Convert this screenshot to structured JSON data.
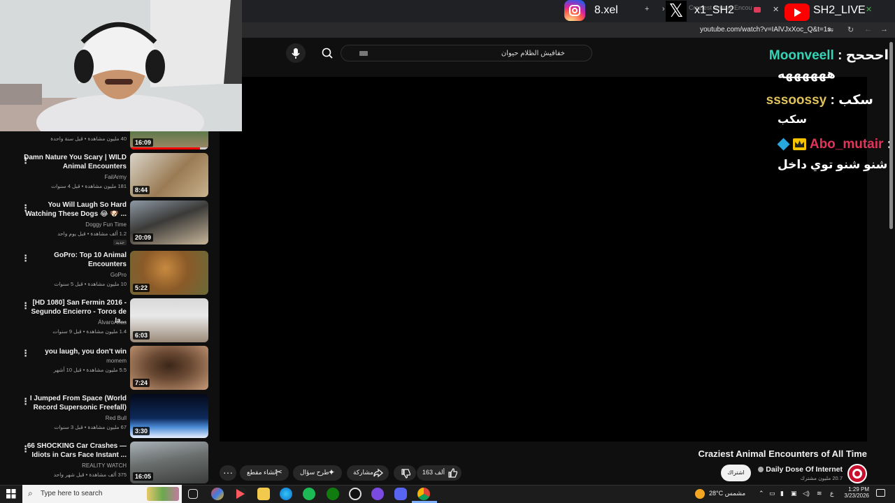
{
  "browser": {
    "tabs": [
      {
        "label": "8.xel"
      },
      {
        "label": "x1_SH2"
      },
      {
        "label": "SH2_LIVE"
      }
    ],
    "tab_faint_title": "Craziest Animal Encounters",
    "url": "youtube.com/watch?v=IAlVJxXoc_Q&t=1s"
  },
  "search": {
    "query": "خفافيش الظلام حيوان"
  },
  "chat": {
    "messages": [
      {
        "user": "Moonveell",
        "sep": ":",
        "prefix": "احححح",
        "text": "ههههههه",
        "color": "#37d3b6"
      },
      {
        "user": "sssoossy",
        "sep": ":",
        "prefix": "سكب",
        "text": "سكب",
        "color": "#e0c25a"
      },
      {
        "user": "Abo_mutair",
        "sep": ":",
        "prefix": "",
        "text": "شنو شنو توي داخل",
        "color": "#e0345a"
      }
    ]
  },
  "recommendations": [
    {
      "title": "",
      "channel": "",
      "meta": "40 مليون مشاهدة • قبل سنة واحدة",
      "duration": "16:09"
    },
    {
      "title": "Damn Nature You Scary | WILD Animal Encounters",
      "channel": "FailArmy",
      "meta": "181 مليون مشاهدة • قبل 4 سنوات",
      "duration": "8:44"
    },
    {
      "title": "You Will Laugh So Hard Watching These Dogs 😂 🐶 ...",
      "channel": "Doggy Fun Time",
      "meta": "1.2 ألف مشاهدة • قبل يوم واحد",
      "badge": "جديد",
      "duration": "20:09"
    },
    {
      "title": "GoPro: Top 10 Animal Encounters",
      "channel": "GoPro",
      "meta": "10 مليون مشاهدة • قبل 5 سنوات",
      "duration": "5:22"
    },
    {
      "title": "[HD 1080] San Fermin 2016 - Segundo Encierro - Toros de la...",
      "channel": "ÁlvaroArias",
      "meta": "1.4 مليون مشاهدة • قبل 9 سنوات",
      "duration": "6:03"
    },
    {
      "title": "you laugh, you don't win",
      "channel": "momem",
      "meta": "5.5 مليون مشاهدة • قبل 10 أشهر",
      "duration": "7:24"
    },
    {
      "title": "I Jumped From Space (World Record Supersonic Freefall)",
      "channel": "Red Bull",
      "meta": "67 مليون مشاهدة • قبل 3 سنوات",
      "duration": "3:30"
    },
    {
      "title": "66 SHOCKING Car Crashes — Idiots in Cars Face Instant ...",
      "channel": "REALITY WATCH",
      "meta": "375 ألف مشاهدة • قبل شهر واحد",
      "duration": "16:05"
    }
  ],
  "video": {
    "title": "Craziest Animal Encounters of All Time",
    "channel": "Daily Dose Of Internet",
    "subs": "20.7 مليون مشترك",
    "subscribe_label": "اشتراك",
    "likes": "163 ألف",
    "share_label": "مشاركة",
    "ask_label": "طرح سؤال",
    "clip_label": "إنشاء مقطع"
  },
  "taskbar": {
    "search_placeholder": "Type here to search",
    "weather": "28°C  مشمس",
    "lang": "ع",
    "time": "1:29 PM",
    "date": "3/23/2026"
  },
  "colors": {
    "accent_red": "#ff0000",
    "bg": "#0f0f0f"
  }
}
